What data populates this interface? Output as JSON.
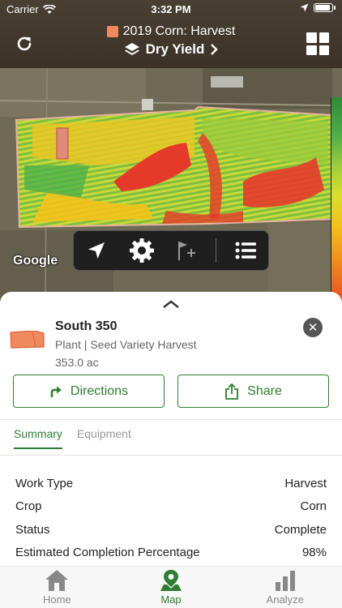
{
  "status_bar": {
    "carrier": "Carrier",
    "time": "3:32 PM"
  },
  "header": {
    "title": "2019 Corn: Harvest",
    "subtitle": "Dry Yield",
    "swatch_color": "#f08a5d",
    "icons": {
      "left": "refresh-icon",
      "right": "grid-icon",
      "layers": "layers-icon",
      "chevron": "chevron-right-icon"
    }
  },
  "map": {
    "attribution": "Google",
    "toolbar": [
      "location-arrow-icon",
      "gear-icon",
      "flag-add-icon",
      "list-icon"
    ]
  },
  "field": {
    "name": "South 350",
    "detail": "Plant | Seed Variety Harvest",
    "area": "353.0 ac"
  },
  "actions": {
    "directions": "Directions",
    "share": "Share"
  },
  "tabs": {
    "summary": "Summary",
    "equipment": "Equipment"
  },
  "summary": [
    {
      "label": "Work Type",
      "value": "Harvest"
    },
    {
      "label": "Crop",
      "value": "Corn"
    },
    {
      "label": "Status",
      "value": "Complete"
    },
    {
      "label": "Estimated Completion Percentage",
      "value": "98%"
    }
  ],
  "nav": {
    "home": "Home",
    "map": "Map",
    "analyze": "Analyze"
  },
  "colors": {
    "accent": "#2e7d32",
    "header": "#3b3127"
  }
}
